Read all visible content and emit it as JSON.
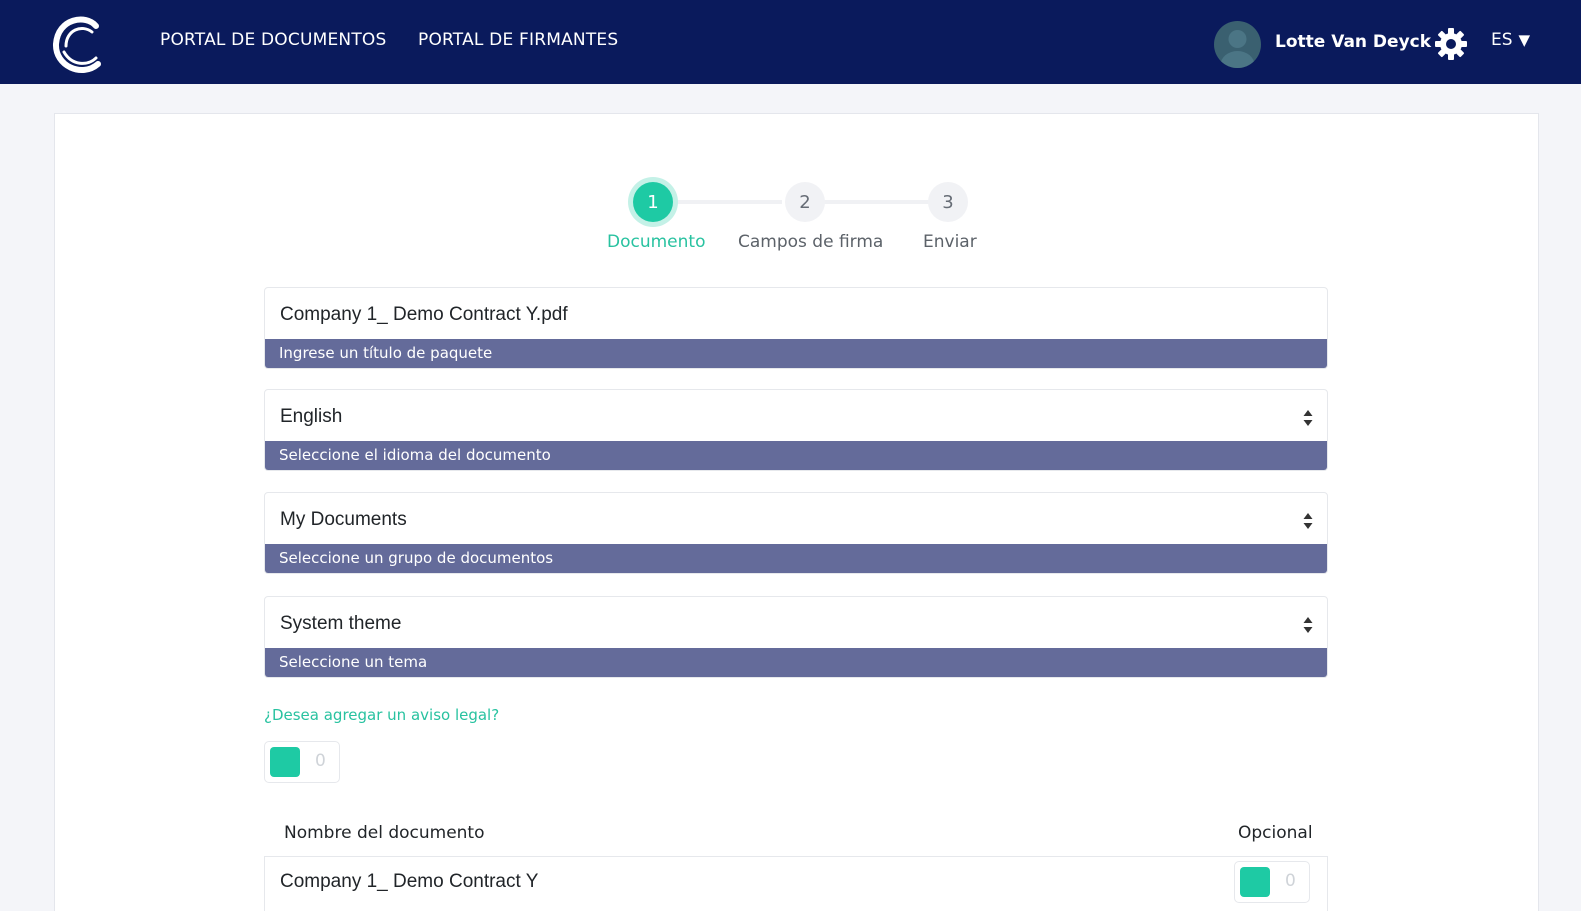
{
  "header": {
    "nav": [
      {
        "label": "PORTAL DE DOCUMENTOS"
      },
      {
        "label": "PORTAL DE FIRMANTES"
      }
    ],
    "user_name": "Lotte Van Deyck",
    "language": "ES"
  },
  "stepper": {
    "steps": [
      {
        "number": "1",
        "label": "Documento",
        "active": true
      },
      {
        "number": "2",
        "label": "Campos de firma",
        "active": false
      },
      {
        "number": "3",
        "label": "Enviar",
        "active": false
      }
    ]
  },
  "form": {
    "package_title": {
      "value": "Company 1_ Demo Contract Y.pdf",
      "hint": "Ingrese un título de paquete"
    },
    "language": {
      "value": "English",
      "hint": "Seleccione el idioma del documento"
    },
    "document_group": {
      "value": "My Documents",
      "hint": "Seleccione un grupo de documentos"
    },
    "theme": {
      "value": "System theme",
      "hint": "Seleccione un tema"
    },
    "legal_notice_question": "¿Desea agregar un aviso legal?",
    "legal_notice_toggle": "0"
  },
  "documents_table": {
    "headers": {
      "name": "Nombre del documento",
      "optional": "Opcional"
    },
    "rows": [
      {
        "name": "Company 1_ Demo Contract Y",
        "optional_toggle": "0"
      }
    ]
  },
  "colors": {
    "header_bg": "#0a1a5c",
    "accent": "#1ecaa4",
    "hint_bg": "#646b9a"
  },
  "icons": [
    "logo-icon",
    "avatar",
    "gear-icon",
    "caret-down-icon",
    "sort-icon"
  ]
}
